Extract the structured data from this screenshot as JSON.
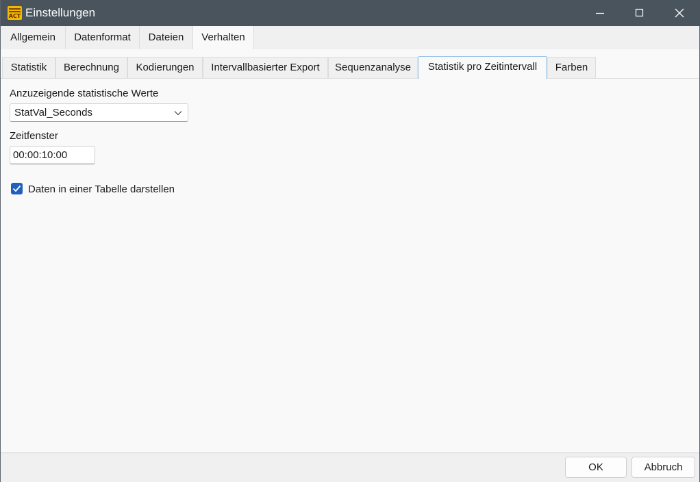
{
  "window": {
    "title": "Einstellungen",
    "app_icon_text": "ACT"
  },
  "main_tabs": [
    {
      "label": "Allgemein"
    },
    {
      "label": "Datenformat"
    },
    {
      "label": "Dateien"
    },
    {
      "label": "Verhalten"
    }
  ],
  "sub_tabs": [
    {
      "label": "Statistik"
    },
    {
      "label": "Berechnung"
    },
    {
      "label": "Kodierungen"
    },
    {
      "label": "Intervallbasierter Export"
    },
    {
      "label": "Sequenzanalyse"
    },
    {
      "label": "Statistik pro Zeitintervall"
    },
    {
      "label": "Farben"
    }
  ],
  "selected_main_tab": "Verhalten",
  "selected_sub_tab": "Statistik pro Zeitintervall",
  "content": {
    "stat_values_label": "Anzuzeigende statistische Werte",
    "stat_values_selected": "StatVal_Seconds",
    "time_window_label": "Zeitfenster",
    "time_window_value": "00:00:10:00",
    "table_checkbox_label": "Daten in einer Tabelle darstellen",
    "table_checkbox_checked": true
  },
  "footer": {
    "ok_label": "OK",
    "cancel_label": "Abbruch"
  },
  "colors": {
    "titlebar": "#4a545c",
    "accent": "#1f5fbf",
    "selected_tab_border": "#9ec4e8"
  }
}
